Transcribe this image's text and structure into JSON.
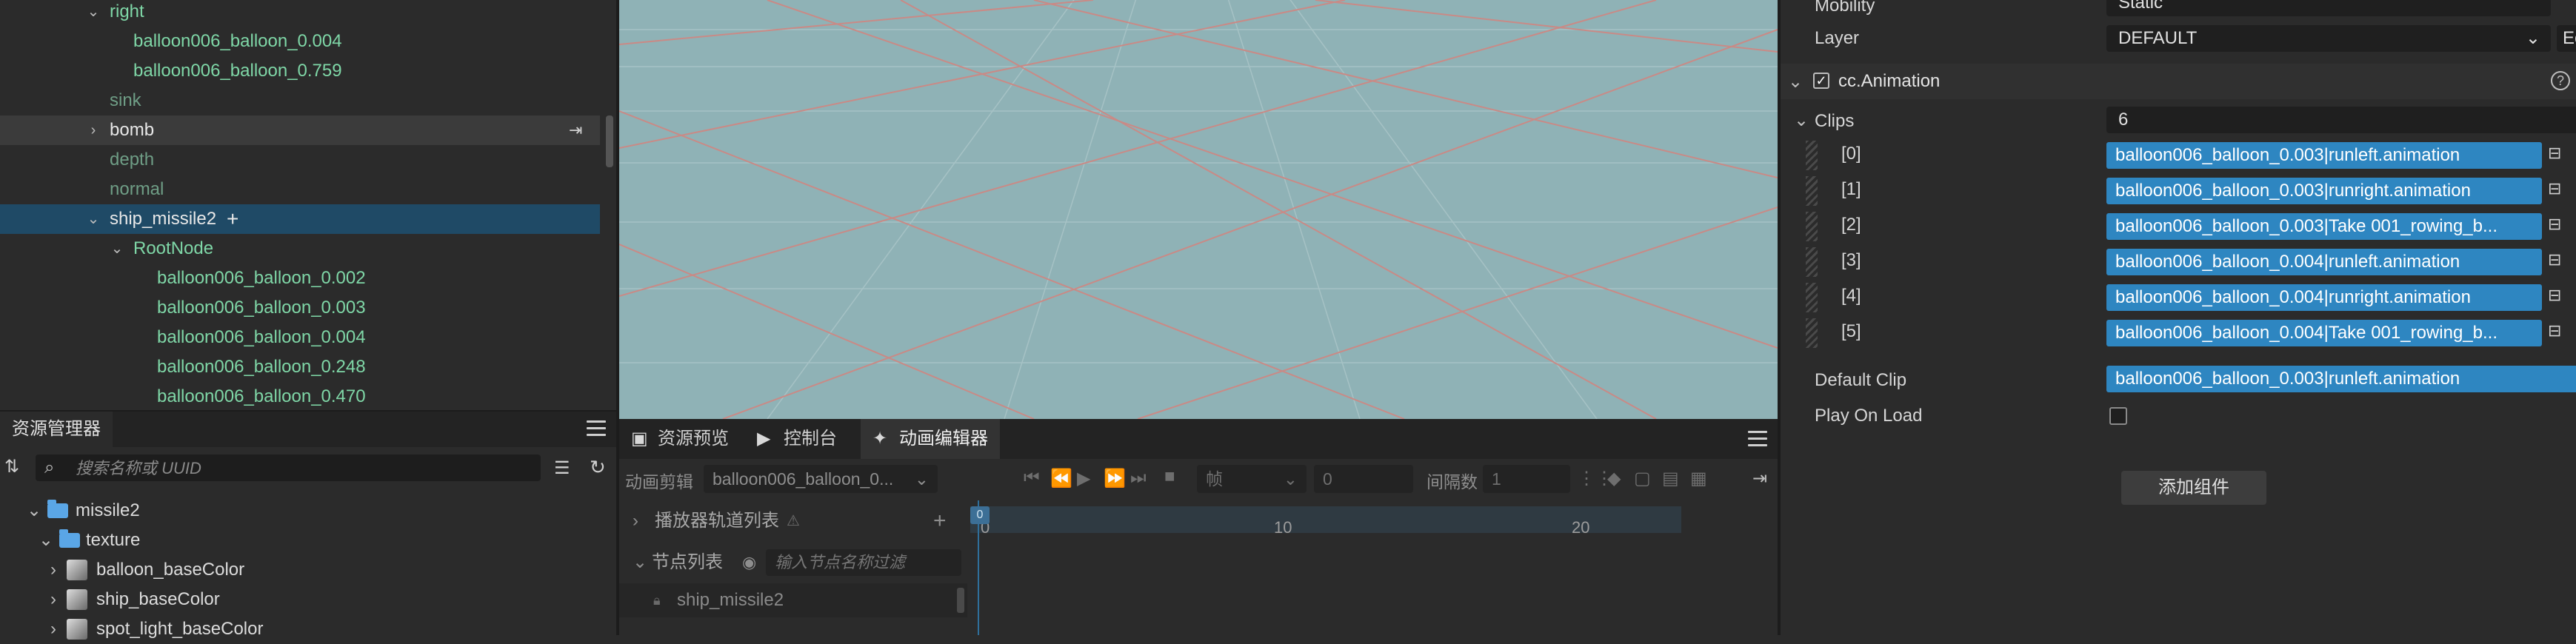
{
  "hierarchy": {
    "rows": [
      {
        "label": "right",
        "expanded": true
      },
      {
        "label": "balloon006_balloon_0.004"
      },
      {
        "label": "balloon006_balloon_0.759"
      },
      {
        "label": "sink"
      },
      {
        "label": "bomb",
        "expanded": false
      },
      {
        "label": "depth"
      },
      {
        "label": "normal"
      },
      {
        "label": "ship_missile2",
        "expanded": true,
        "selected": true
      },
      {
        "label": "RootNode",
        "expanded": true
      },
      {
        "label": "balloon006_balloon_0.002"
      },
      {
        "label": "balloon006_balloon_0.003"
      },
      {
        "label": "balloon006_balloon_0.004"
      },
      {
        "label": "balloon006_balloon_0.248"
      },
      {
        "label": "balloon006_balloon_0.470"
      }
    ]
  },
  "assets": {
    "tab_label": "资源管理器",
    "search_placeholder": "搜索名称或 UUID",
    "rows": [
      {
        "label": "missile2",
        "type": "folder"
      },
      {
        "label": "texture",
        "type": "folder"
      },
      {
        "label": "balloon_baseColor",
        "type": "texture"
      },
      {
        "label": "ship_baseColor",
        "type": "texture"
      },
      {
        "label": "spot_light_baseColor",
        "type": "texture"
      }
    ]
  },
  "bottom_panel": {
    "tabs": [
      {
        "label": "资源预览",
        "icon": "image-icon"
      },
      {
        "label": "控制台",
        "icon": "terminal-icon"
      },
      {
        "label": "动画编辑器",
        "icon": "running-figure-icon",
        "active": true
      }
    ],
    "toolbar": {
      "clip_label": "动画剪辑",
      "clip_value": "balloon006_balloon_0...",
      "frame_unit": "帧",
      "frame_value": "0",
      "interval_label": "间隔数",
      "interval_value": "1"
    },
    "sections": {
      "player_tracks": "播放器轨道列表",
      "node_list": "节点列表",
      "node_filter_placeholder": "输入节点名称过滤",
      "node_item": "ship_missile2"
    },
    "timeline": {
      "ticks": [
        "0",
        "10",
        "20"
      ]
    }
  },
  "inspector": {
    "mobility_label": "Mobility",
    "mobility_value": "Static",
    "layer_label": "Layer",
    "layer_value": "DEFAULT",
    "layer_edit": "Ec",
    "component_name": "cc.Animation",
    "clips_label": "Clips",
    "clips_count": "6",
    "clips": [
      {
        "index": "[0]",
        "value": "balloon006_balloon_0.003|runleft.animation"
      },
      {
        "index": "[1]",
        "value": "balloon006_balloon_0.003|runright.animation"
      },
      {
        "index": "[2]",
        "value": "balloon006_balloon_0.003|Take 001_rowing_b..."
      },
      {
        "index": "[3]",
        "value": "balloon006_balloon_0.004|runleft.animation"
      },
      {
        "index": "[4]",
        "value": "balloon006_balloon_0.004|runright.animation"
      },
      {
        "index": "[5]",
        "value": "balloon006_balloon_0.004|Take 001_rowing_b..."
      }
    ],
    "default_clip_label": "Default Clip",
    "default_clip_value": "balloon006_balloon_0.003|runleft.animation",
    "play_on_load_label": "Play On Load",
    "play_on_load": false,
    "add_component_label": "添加组件"
  },
  "colors": {
    "viewport_bg": "#8fb2b6",
    "grid_line": "#c98a86",
    "selection": "#1f4a66",
    "clip_field": "#2e86c1",
    "node_green": "#7fd7a7"
  }
}
